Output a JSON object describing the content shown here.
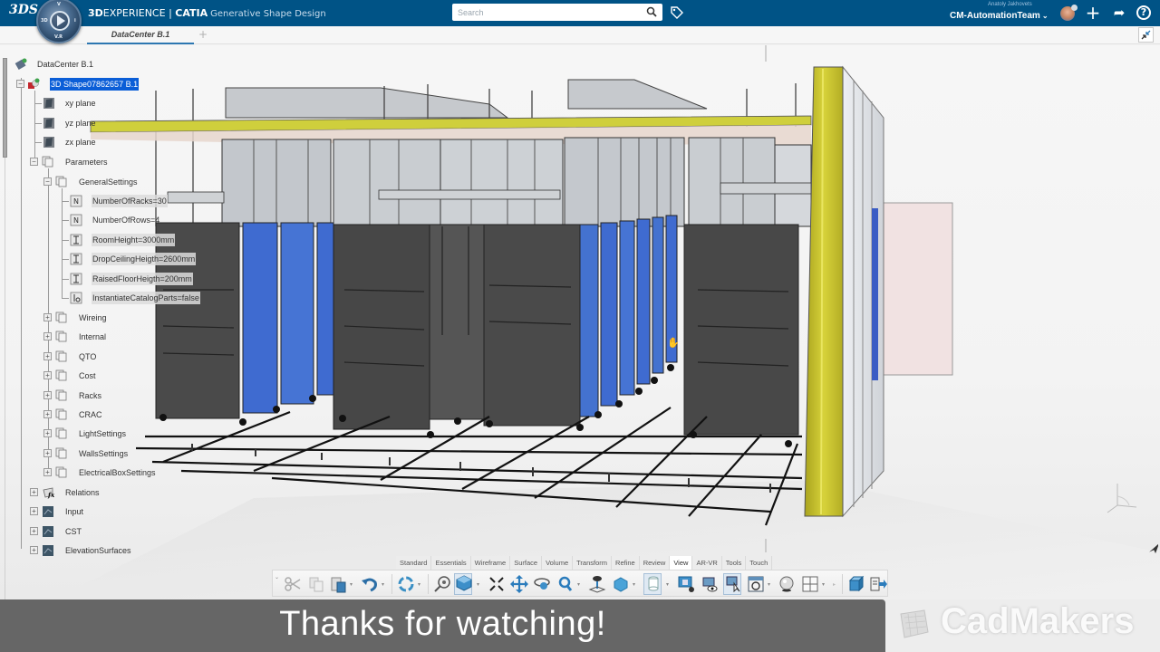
{
  "topbar": {
    "brand_logo": "3DS",
    "compass": {
      "top_label": "V",
      "left_label": "3D",
      "right_label": "i",
      "bottom_label": "V.R"
    },
    "title_brand": "3D",
    "title_experience": "EXPERIENCE",
    "title_separator": " | ",
    "title_app": "CATIA",
    "title_workbench": "Generative Shape Design",
    "search": {
      "placeholder": "Search",
      "value": ""
    },
    "user_name": "Anatoly Jakhovets",
    "team": "CM-AutomationTeam",
    "icons": [
      "search-icon",
      "tag-icon",
      "avatar",
      "add-icon",
      "share-icon",
      "help-icon"
    ],
    "add_glyph": "+",
    "share_glyph": "➦",
    "help_glyph": "?"
  },
  "tabs": {
    "items": [
      {
        "label": "DataCenter B.1",
        "active": true
      }
    ],
    "add_label": "+"
  },
  "tree": {
    "root": "DataCenter B.1",
    "selected": "3D Shape07862657 B.1",
    "planes": [
      "xy plane",
      "yz plane",
      "zx plane"
    ],
    "parameters_label": "Parameters",
    "general_settings_label": "GeneralSettings",
    "general_parameters": [
      {
        "label": "NumberOfRacks=30",
        "type": "integer"
      },
      {
        "label": "NumberOfRows=4",
        "type": "integer"
      },
      {
        "label": "RoomHeight=3000mm",
        "type": "length"
      },
      {
        "label": "DropCeilingHeigth=2600mm",
        "type": "length"
      },
      {
        "label": "RaisedFloorHeigth=200mm",
        "type": "length"
      },
      {
        "label": "InstantiateCatalogParts=false",
        "type": "boolean"
      }
    ],
    "parameter_sets": [
      "Wireing",
      "Internal",
      "QTO",
      "Cost",
      "Racks",
      "CRAC",
      "LightSettings",
      "WallsSettings",
      "ElectricalBoxSettings"
    ],
    "bottom_nodes": [
      "Relations",
      "Input",
      "CST",
      "ElevationSurfaces"
    ]
  },
  "action_bar": {
    "tabs": [
      "Standard",
      "Essentials",
      "Wireframe",
      "Surface",
      "Volume",
      "Transform",
      "Refine",
      "Review",
      "View",
      "AR-VR",
      "Tools",
      "Touch"
    ],
    "active_tab": "View",
    "tools": [
      "cut",
      "copy",
      "paste",
      "undo",
      "update",
      "zoom-area",
      "view-mode",
      "fit-all",
      "pan",
      "rotate",
      "zoom",
      "look-at",
      "normal-view",
      "cylinder",
      "render-settings",
      "hide-show",
      "select-mode",
      "refresh-view",
      "lighting",
      "multi-view",
      "3d-box",
      "export"
    ]
  },
  "overlay": {
    "caption": "Thanks for watching!",
    "watermark": "CadMakers"
  },
  "colors": {
    "topbar": "#005386",
    "selection": "#0b5ed7",
    "rack_blue": "#4b74c9",
    "rack_dark": "#4a4a4a",
    "wall_yellow": "#c9c430",
    "caption_bg": "#666666"
  }
}
